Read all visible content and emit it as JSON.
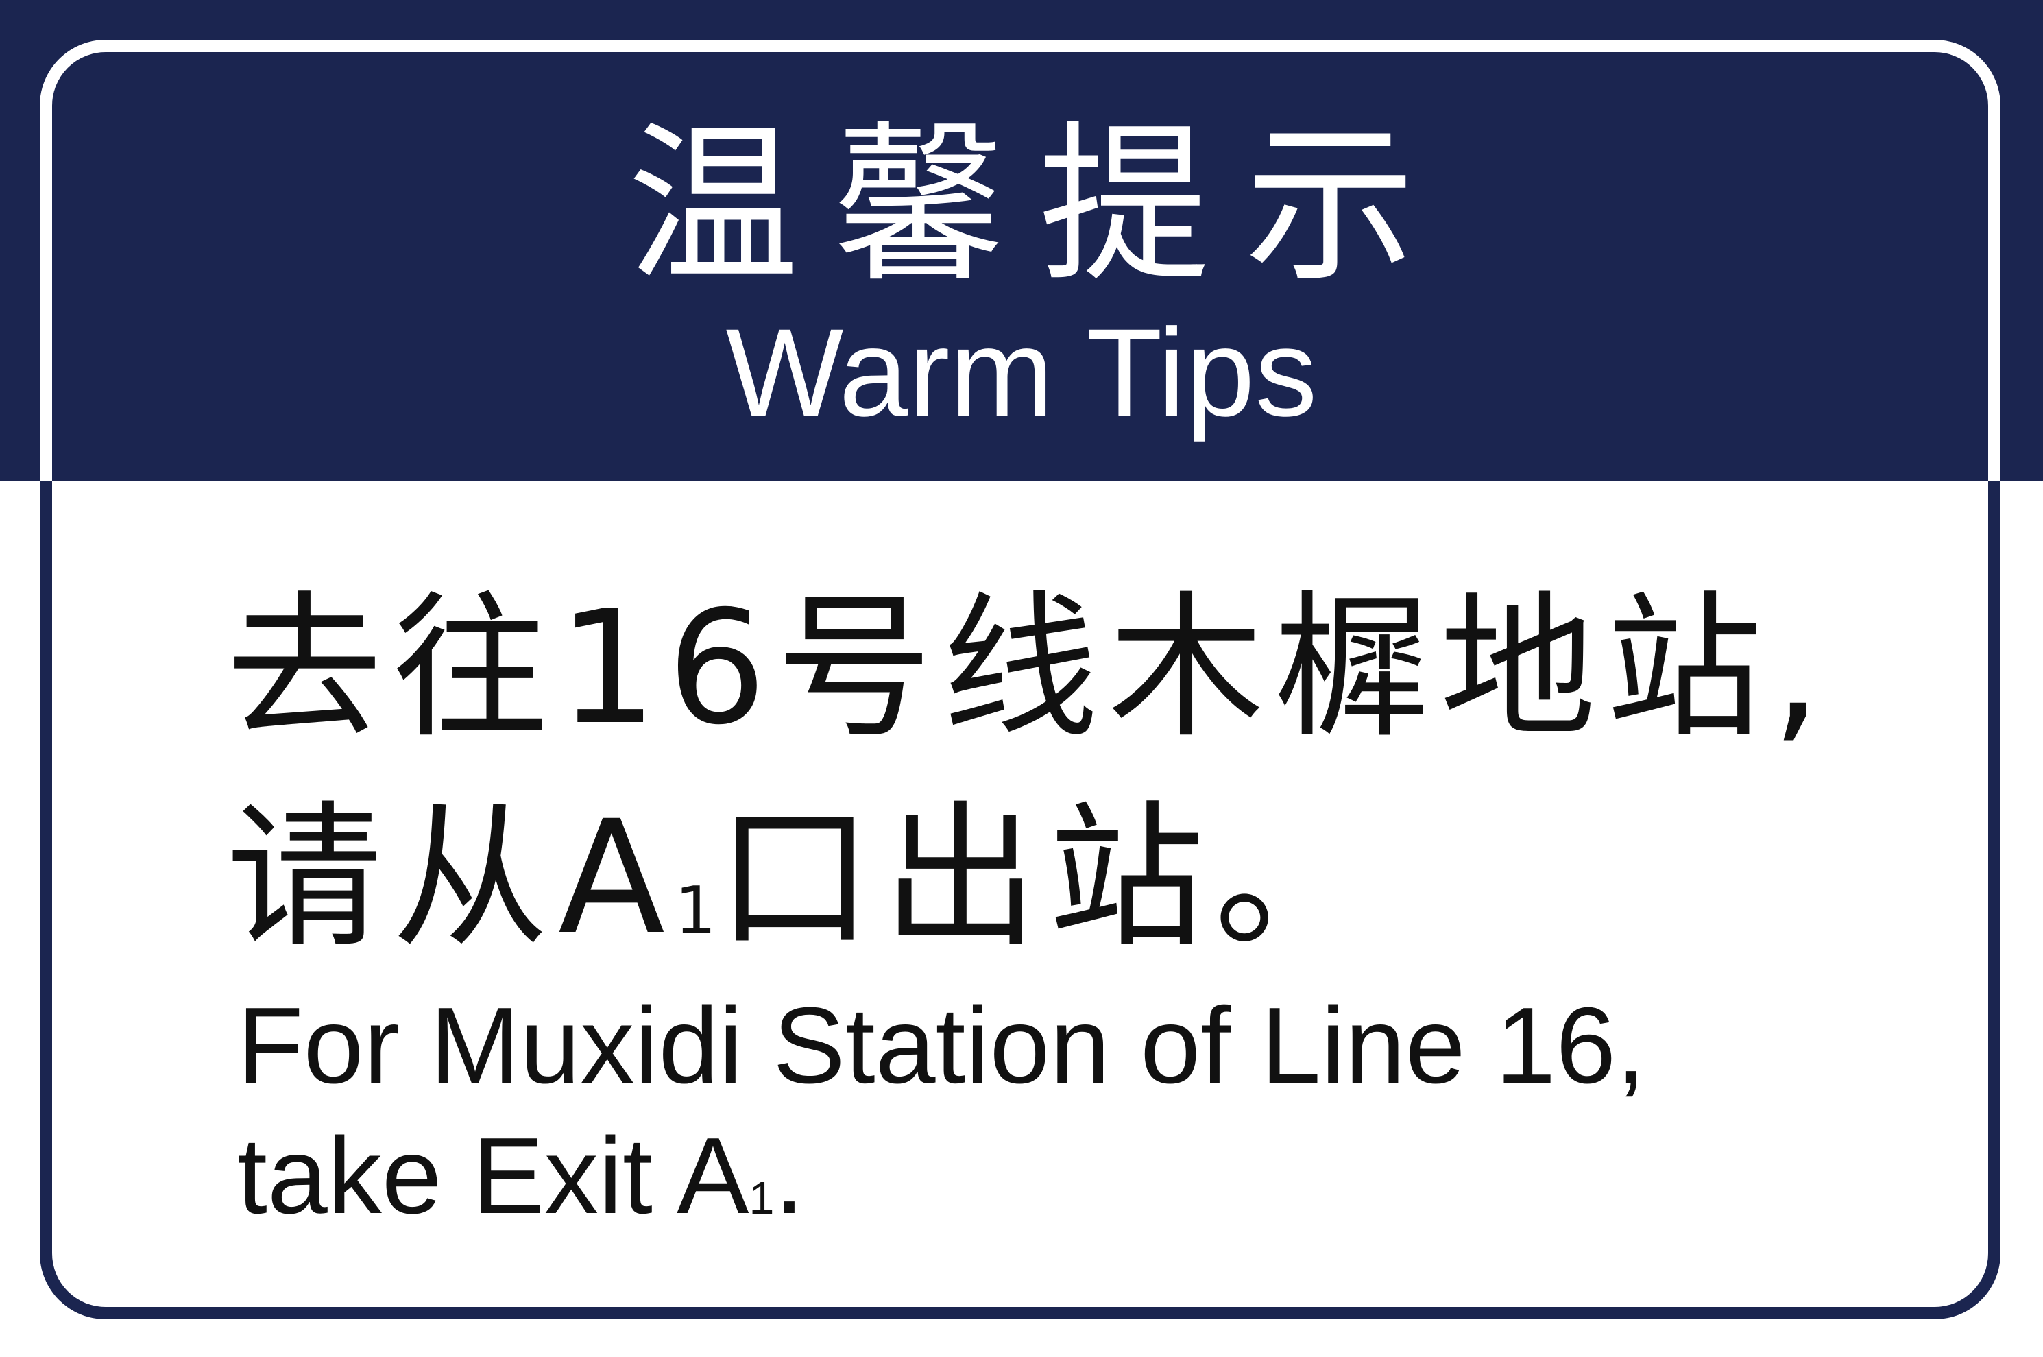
{
  "sign": {
    "header_zh": "温馨提示",
    "header_en": "Warm Tips",
    "message_zh_line1": "去往16号线木樨地站,",
    "message_zh_line2_prefix": "请从A",
    "message_zh_line2_sub": "1",
    "message_zh_line2_suffix": "口出站。",
    "message_en_line1": "For Muxidi Station of Line 16,",
    "message_en_line2_prefix": "take Exit A",
    "message_en_line2_sub": "1",
    "message_en_line2_suffix": "."
  },
  "colors": {
    "header_background": "#1b2550",
    "body_background": "#ffffff",
    "header_text": "#ffffff",
    "body_text": "#111111"
  }
}
